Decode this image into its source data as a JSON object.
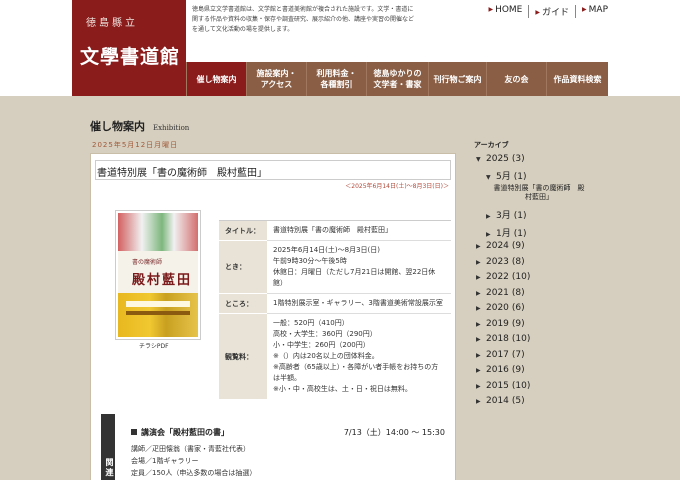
{
  "header": {
    "logo_subtitle": "徳島縣立",
    "logo_title": "文學書道館",
    "intro": "徳島県立文学書道館は、文学館と書道美術館が複合された施設です。文学・書道に関する作品や資料の収集・保存や調査研究、展示紹介の他、講座や実習の開催などを通して文化活動の場を提供します。",
    "top_nav": [
      "HOME",
      "ガイド",
      "MAP"
    ]
  },
  "main_nav": [
    {
      "label": "催し物案内",
      "active": true
    },
    {
      "label": "施設案内・\nアクセス",
      "active": false
    },
    {
      "label": "利用料金・\n各種割引",
      "active": false
    },
    {
      "label": "徳島ゆかりの\n文学者・書家",
      "active": false
    },
    {
      "label": "刊行物ご案内",
      "active": false
    },
    {
      "label": "友の会",
      "active": false
    },
    {
      "label": "作品資料検索",
      "active": false
    }
  ],
  "page": {
    "title": "催し物案内",
    "title_en": "Exhibition",
    "date_heading": "2025年5月12日月曜日"
  },
  "event": {
    "title": "書道特別展「書の魔術師　殿村藍田」",
    "period": "＜2025年6月14日(土)～8月3日(日)＞",
    "flyer_t1": "書の魔術師",
    "flyer_t2": "殿村藍田",
    "flyer_link": "チラシPDF",
    "rows": [
      {
        "label": "タイトル：",
        "value": "書道特別展「書の魔術師　殿村藍田」"
      },
      {
        "label": "とき：",
        "value": "2025年6月14日(土)～8月3日(日)\n午前9時30分～午後5時\n休館日：月曜日（ただし7月21日は開館、翌22日休館）"
      },
      {
        "label": "ところ：",
        "value": "1階特別展示室・ギャラリー、3階書道美術常設展示室"
      },
      {
        "label": "観覧料：",
        "value": "一般：520円（410円）\n高校・大学生：360円（290円）\n小・中学生：260円（200円）\n※（）内は20名以上の団体料金。\n※高齢者（65歳以上）・各障がい者手帳をお持ちの方は半額。\n※小・中・高校生は、土・日・祝日は無料。"
      }
    ]
  },
  "related": {
    "tab_label": "関連",
    "lecture_title": "講演会「殿村藍田の書」",
    "lecture_time": "7/13（土）14:00 ～ 15:30",
    "lecture_details": [
      "講師／疋田懐翁（書家・青藍社代表）",
      "会場／1階ギャラリー",
      "定員／150人（申込多数の場合は抽選）"
    ]
  },
  "sidebar": {
    "archive_title": "アーカイブ",
    "archive": [
      {
        "label": "2025",
        "count": "(3)",
        "expanded": true,
        "indent": 0
      },
      {
        "label": "5月",
        "count": "(1)",
        "expanded": true,
        "indent": 1
      },
      {
        "label": "書道特別展「書の魔術師　殿村藍田」",
        "count": "",
        "expanded": false,
        "indent": 2
      },
      {
        "label": "3月",
        "count": "(1)",
        "expanded": false,
        "indent": 1
      },
      {
        "label": "1月",
        "count": "(1)",
        "expanded": false,
        "indent": 1
      },
      {
        "label": "2024",
        "count": "(9)",
        "expanded": false,
        "indent": 0
      },
      {
        "label": "2023",
        "count": "(8)",
        "expanded": false,
        "indent": 0
      },
      {
        "label": "2022",
        "count": "(10)",
        "expanded": false,
        "indent": 0
      },
      {
        "label": "2021",
        "count": "(8)",
        "expanded": false,
        "indent": 0
      },
      {
        "label": "2020",
        "count": "(6)",
        "expanded": false,
        "indent": 0
      },
      {
        "label": "2019",
        "count": "(9)",
        "expanded": false,
        "indent": 0
      },
      {
        "label": "2018",
        "count": "(10)",
        "expanded": false,
        "indent": 0
      },
      {
        "label": "2017",
        "count": "(7)",
        "expanded": false,
        "indent": 0
      },
      {
        "label": "2016",
        "count": "(9)",
        "expanded": false,
        "indent": 0
      },
      {
        "label": "2015",
        "count": "(10)",
        "expanded": false,
        "indent": 0
      },
      {
        "label": "2014",
        "count": "(5)",
        "expanded": false,
        "indent": 0
      }
    ]
  },
  "colors": {
    "brand": "#8a1c1c",
    "nav": "#8a5e45",
    "background": "#d6cfbf"
  }
}
